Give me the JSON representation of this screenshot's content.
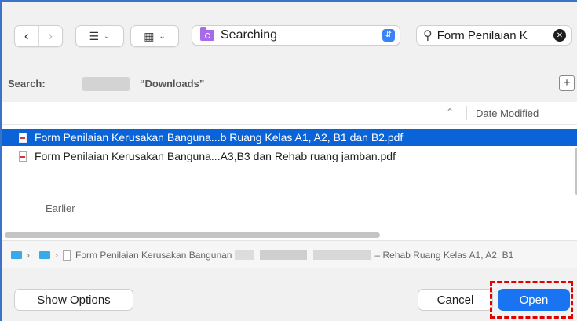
{
  "toolbar": {
    "back_icon": "chevron-left-icon",
    "forward_icon": "chevron-right-icon",
    "list_view_icon": "list-view-icon",
    "grid_view_icon": "grid-view-icon",
    "location": "Searching",
    "search_query": "Form Penilaian K"
  },
  "scope": {
    "label": "Search:",
    "downloads": "“Downloads”",
    "add_label": "+"
  },
  "list": {
    "sort_column": "Date Modified",
    "files": [
      {
        "name": "Form Penilaian Kerusakan Banguna...b Ruang Kelas A1, A2, B1 dan B2.pdf",
        "selected": true
      },
      {
        "name": "Form Penilaian Kerusakan Banguna...A3,B3 dan Rehab ruang jamban.pdf",
        "selected": false
      }
    ],
    "section_earlier": "Earlier"
  },
  "pathbar": {
    "file_label": "Form Penilaian Kerusakan Bangunan",
    "suffix": "– Rehab Ruang Kelas A1, A2, B1"
  },
  "buttons": {
    "show_options": "Show Options",
    "cancel": "Cancel",
    "open": "Open"
  },
  "colors": {
    "accent": "#1a73f0",
    "selection": "#0a64d8",
    "folder": "#a86ae6",
    "highlight": "#e00000"
  }
}
